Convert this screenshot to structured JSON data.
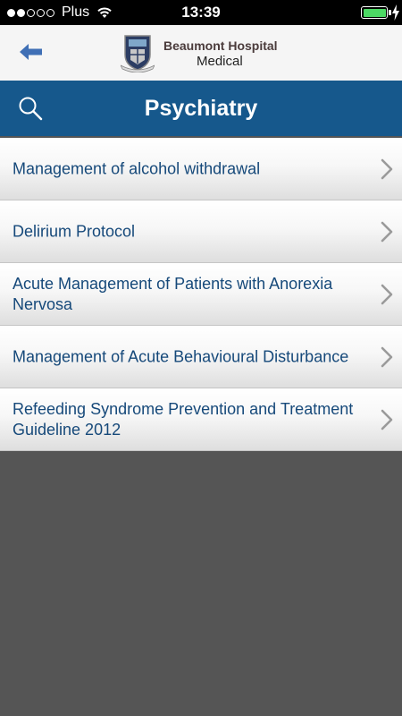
{
  "status_bar": {
    "carrier": "Plus",
    "time": "13:39",
    "signal_bars": 2,
    "signal_total": 5,
    "battery_level": 1.0,
    "battery_color": "#4cd964"
  },
  "header": {
    "brand_name": "Beaumont Hospital",
    "brand_subtitle": "Medical",
    "back_icon": "arrow-left-icon",
    "logo": "hospital-crest"
  },
  "title_bar": {
    "title": "Psychiatry",
    "background": "#16588c",
    "search_icon": "search-icon"
  },
  "list": {
    "items": [
      {
        "label": "Management of alcohol withdrawal"
      },
      {
        "label": "Delirium Protocol"
      },
      {
        "label": "Acute Management of Patients with Anorexia Nervosa"
      },
      {
        "label": "Management of Acute Behavioural Disturbance"
      },
      {
        "label": "Refeeding Syndrome Prevention and Treatment Guideline 2012"
      }
    ],
    "text_color": "#16497a"
  }
}
